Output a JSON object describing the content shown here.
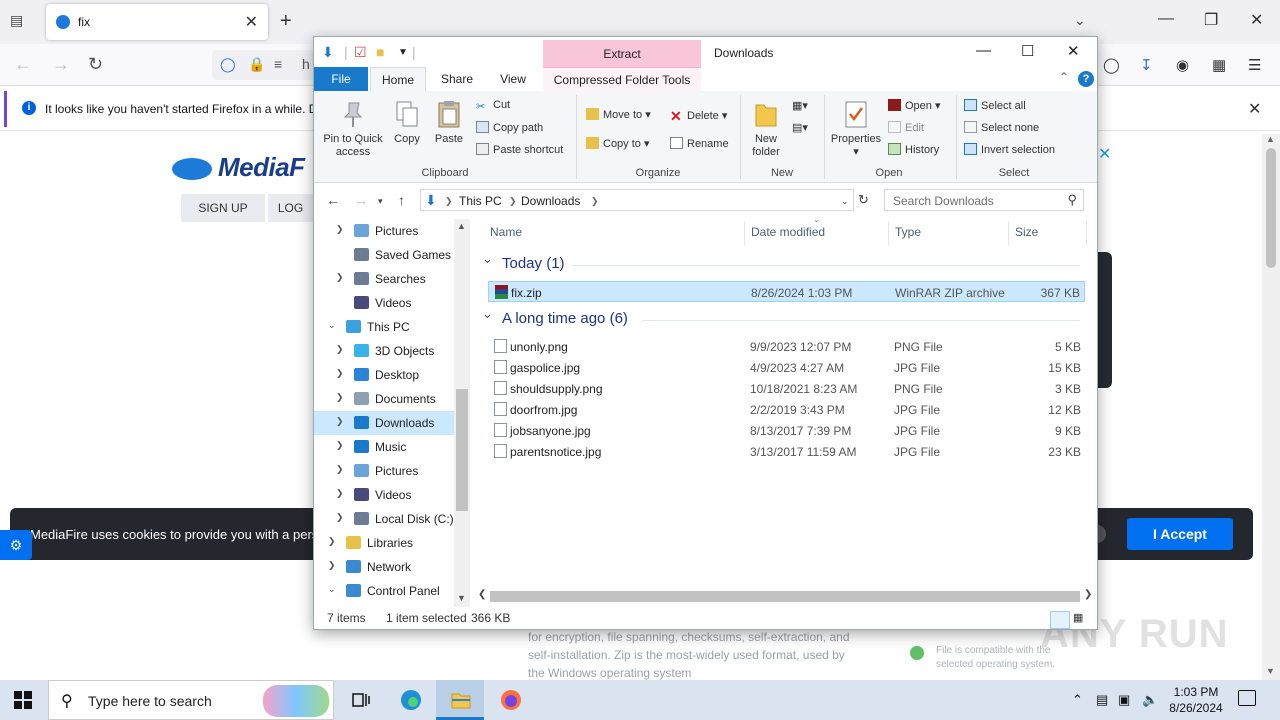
{
  "browser": {
    "tab_title": "fix",
    "url_fragment": "h",
    "notification": "It looks like you haven't started Firefox in a while. D"
  },
  "mediafire": {
    "logo": "MediaF",
    "signup": "SIGN UP",
    "login": "LOG",
    "cookie_text": "MediaFire uses cookies to provide you with a pers",
    "accept": "I Accept",
    "description": "for encryption, file spanning, checksums, self-extraction, and self-installation. Zip is the most-widely used format, used by the Windows operating system",
    "compat": "File is compatible with the selected operating system."
  },
  "watermark": "ANY RUN",
  "explorer": {
    "title": "Downloads",
    "extract_label": "Extract",
    "tabs": {
      "file": "File",
      "home": "Home",
      "share": "Share",
      "view": "View",
      "compressed": "Compressed Folder Tools"
    },
    "ribbon": {
      "clipboard": {
        "pin": "Pin to Quick access",
        "copy": "Copy",
        "paste": "Paste",
        "cut": "Cut",
        "copy_path": "Copy path",
        "paste_shortcut": "Paste shortcut",
        "label": "Clipboard"
      },
      "organize": {
        "move_to": "Move to",
        "copy_to": "Copy to",
        "delete": "Delete",
        "rename": "Rename",
        "label": "Organize"
      },
      "new": {
        "new_folder": "New folder",
        "label": "New"
      },
      "open": {
        "properties": "Properties",
        "open": "Open",
        "edit": "Edit",
        "history": "History",
        "label": "Open"
      },
      "select": {
        "select_all": "Select all",
        "select_none": "Select none",
        "invert": "Invert selection",
        "label": "Select"
      }
    },
    "address": {
      "this_pc": "This PC",
      "downloads": "Downloads",
      "search_placeholder": "Search Downloads"
    },
    "nav": [
      {
        "label": "Pictures",
        "level": 2,
        "arrow": "right",
        "icon": "pictures"
      },
      {
        "label": "Saved Games",
        "level": 2,
        "arrow": "",
        "icon": "savedgames"
      },
      {
        "label": "Searches",
        "level": 2,
        "arrow": "right",
        "icon": "searches"
      },
      {
        "label": "Videos",
        "level": 2,
        "arrow": "",
        "icon": "videos"
      },
      {
        "label": "This PC",
        "level": 1,
        "arrow": "down",
        "icon": "thispc"
      },
      {
        "label": "3D Objects",
        "level": 2,
        "arrow": "right",
        "icon": "3dobjects"
      },
      {
        "label": "Desktop",
        "level": 2,
        "arrow": "right",
        "icon": "desktop"
      },
      {
        "label": "Documents",
        "level": 2,
        "arrow": "right",
        "icon": "documents"
      },
      {
        "label": "Downloads",
        "level": 2,
        "arrow": "right",
        "icon": "downloads",
        "selected": true
      },
      {
        "label": "Music",
        "level": 2,
        "arrow": "right",
        "icon": "music"
      },
      {
        "label": "Pictures",
        "level": 2,
        "arrow": "right",
        "icon": "pictures"
      },
      {
        "label": "Videos",
        "level": 2,
        "arrow": "right",
        "icon": "videos"
      },
      {
        "label": "Local Disk (C:)",
        "level": 2,
        "arrow": "right",
        "icon": "disk"
      },
      {
        "label": "Libraries",
        "level": 1,
        "arrow": "right",
        "icon": "libraries"
      },
      {
        "label": "Network",
        "level": 1,
        "arrow": "right",
        "icon": "network"
      },
      {
        "label": "Control Panel",
        "level": 1,
        "arrow": "down",
        "icon": "controlpanel"
      }
    ],
    "columns": {
      "name": "Name",
      "date": "Date modified",
      "type": "Type",
      "size": "Size"
    },
    "groups": [
      {
        "label": "Today (1)",
        "files": [
          {
            "name": "fix.zip",
            "date": "8/26/2024 1:03 PM",
            "type": "WinRAR ZIP archive",
            "size": "367 KB",
            "selected": true,
            "icon": "winrar"
          }
        ]
      },
      {
        "label": "A long time ago (6)",
        "files": [
          {
            "name": "unonly.png",
            "date": "9/9/2023 12:07 PM",
            "type": "PNG File",
            "size": "5 KB",
            "icon": "image"
          },
          {
            "name": "gaspolice.jpg",
            "date": "4/9/2023 4:27 AM",
            "type": "JPG File",
            "size": "15 KB",
            "icon": "image"
          },
          {
            "name": "shouldsupply.png",
            "date": "10/18/2021 8:23 AM",
            "type": "PNG File",
            "size": "3 KB",
            "icon": "image"
          },
          {
            "name": "doorfrom.jpg",
            "date": "2/2/2019 3:43 PM",
            "type": "JPG File",
            "size": "12 KB",
            "icon": "image"
          },
          {
            "name": "jobsanyone.jpg",
            "date": "8/13/2017 7:39 PM",
            "type": "JPG File",
            "size": "9 KB",
            "icon": "image"
          },
          {
            "name": "parentsnotice.jpg",
            "date": "3/13/2017 11:59 AM",
            "type": "JPG File",
            "size": "23 KB",
            "icon": "image"
          }
        ]
      }
    ],
    "status": {
      "items": "7 items",
      "selected": "1 item selected",
      "size": "366 KB"
    }
  },
  "taskbar": {
    "search_placeholder": "Type here to search",
    "time": "1:03 PM",
    "date": "8/26/2024"
  }
}
